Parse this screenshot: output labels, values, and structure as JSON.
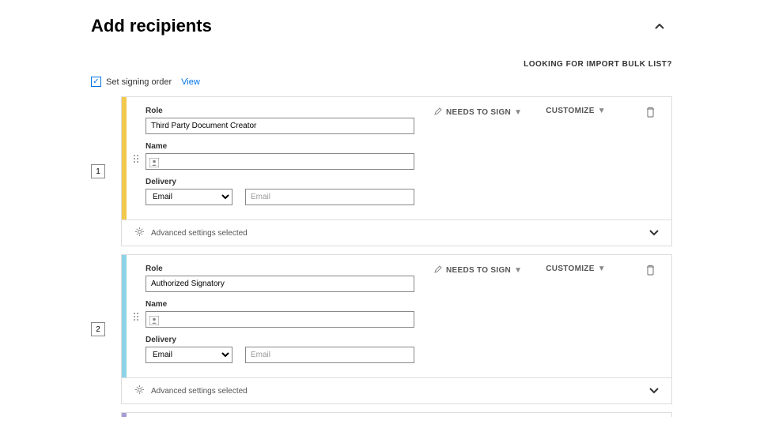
{
  "header": {
    "title": "Add recipients"
  },
  "bulk_link": "LOOKING FOR IMPORT BULK LIST?",
  "signing_order": {
    "checked": true,
    "label": "Set signing order",
    "view": "View"
  },
  "labels": {
    "role": "Role",
    "name": "Name",
    "delivery": "Delivery"
  },
  "actions": {
    "needs_to_sign": "NEEDS TO SIGN",
    "customize": "CUSTOMIZE",
    "advanced": "Advanced settings selected"
  },
  "delivery_options": {
    "email": "Email"
  },
  "placeholders": {
    "email": "Email"
  },
  "recipients": [
    {
      "order": "1",
      "role": "Third Party Document Creator",
      "name": "",
      "delivery": "Email",
      "email": ""
    },
    {
      "order": "2",
      "role": "Authorized Signatory",
      "name": "",
      "delivery": "Email",
      "email": ""
    }
  ]
}
